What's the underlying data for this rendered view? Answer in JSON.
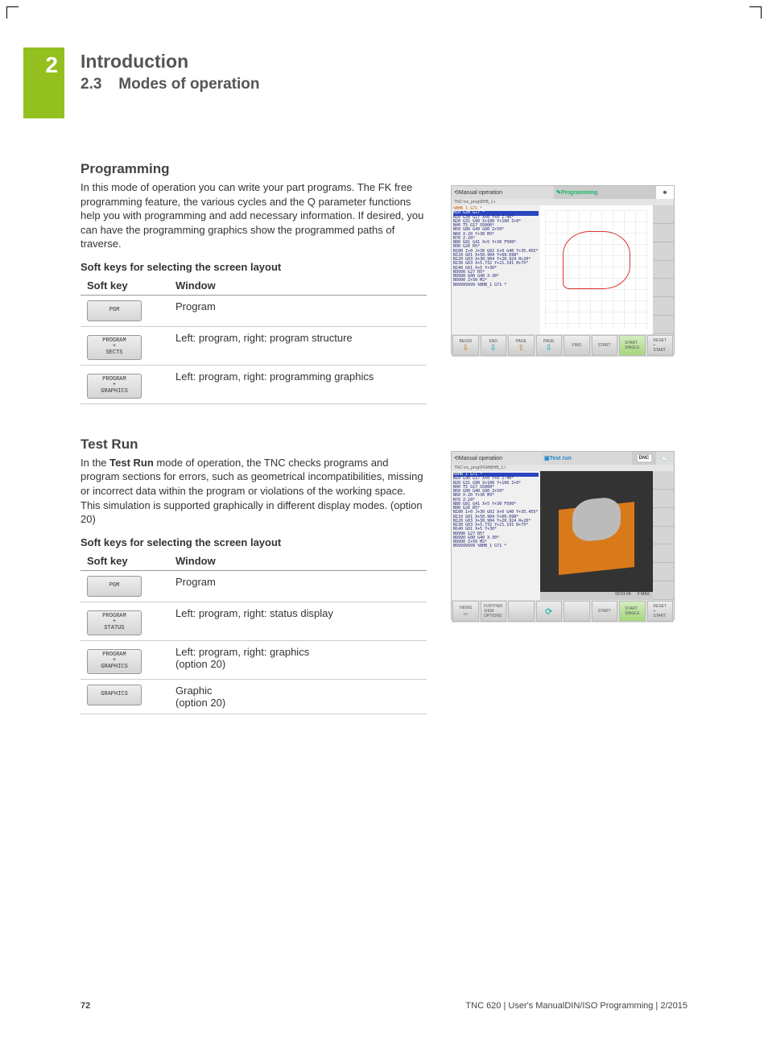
{
  "chapter": {
    "number": "2",
    "title": "Introduction",
    "sectionNum": "2.3",
    "sectionTitle": "Modes of operation"
  },
  "prog": {
    "heading": "Programming",
    "para": "In this mode of operation you can write your part programs. The FK free programming feature, the various cycles and the Q parameter functions help you with programming and add necessary information. If desired, you can have the programming graphics show the programmed paths of traverse.",
    "tableTitle": "Soft keys for selecting the screen layout",
    "h1": "Soft key",
    "h2": "Window",
    "r1": {
      "k1": "PGM",
      "w": "Program"
    },
    "r2": {
      "k1": "PROGRAM",
      "k2": "+",
      "k3": "SECTS",
      "w": "Left: program, right: program structure"
    },
    "r3": {
      "k1": "PROGRAM",
      "k2": "+",
      "k3": "GRAPHICS",
      "w": "Left: program, right: programming graphics"
    }
  },
  "test": {
    "heading": "Test Run",
    "para1": "In the ",
    "bold": "Test Run",
    "para2": " mode of operation, the TNC checks programs and program sections for errors, such as geometrical incompatibilities, missing or incorrect data within the program or violations of the working space. This simulation is supported graphically in different display modes. (option 20)",
    "tableTitle": "Soft keys for selecting the screen layout",
    "h1": "Soft key",
    "h2": "Window",
    "r1": {
      "k1": "PGM",
      "w": "Program"
    },
    "r2": {
      "k1": "PROGRAM",
      "k2": "+",
      "k3": "STATUS",
      "w": "Left: program, right: status display"
    },
    "r3": {
      "k1": "PROGRAM",
      "k2": "+",
      "k3": "GRAPHICS",
      "w1": "Left: program, right: graphics",
      "w2": "(option 20)"
    },
    "r4": {
      "k1": "GRAPHICS",
      "w1": "Graphic",
      "w2": "(option 20)"
    }
  },
  "ss1": {
    "tab1": "Manual operation",
    "tab2": "Programming",
    "sub": "Programming",
    "path": "TNC:\\nc_prog\\BHB_1.i",
    "line0": "%BHB_1 G71 *",
    "hl": "N10 G30 G17 *",
    "code": "N10 G30 G17 X+0 Y+0 Z-40*\nN20 G31 G90 X+100 Y+100 Z+0*\nN40 T5 G17 S5000*\nN50 G00 G40 G90 Z+50*\nN60 X-20 Y+30 M3*\nN70 Z-20*\nN80 G01 G41 X+5 Y+30 F500*\nN90 G26 R5*\nN100 I+0 J+30 G02 X+0 G40 Y+35.455*\nN110 G01 X+50.904 Y+60.698*\nN120 G03 X+30.904 Y+20.924 R+20*\nN130 G03 X+5.732 Y+21.191 R+75*\nN140 G01 X+5 Y+30*\nN9990 G27 R5*\nN9990 G00 G40 X-30*\nN9990 Z+50 M2*\nN99999999 %BHB_1 G71 *",
    "buttons": [
      "BEGIN",
      "END",
      "PAGE",
      "PAGE",
      "FIND",
      "START",
      "START\nSINGLE",
      "RESET\n+\nSTART"
    ]
  },
  "ss2": {
    "tab1": "Manual operation",
    "tab2": "Test run",
    "dnc": "DNC",
    "path": "TNC:\\nc_prog\\PGM\\BHB_1.I",
    "hl": "%BHB_1 G71 *",
    "code": "N10 G30 G17 X+0 Y+0 Z-40*\nN20 G31 G90 X+100 Y+100 Z+0*\nN40 T5 G17 S5000*\nN50 G00 G40 G90 Z+50*\nN60 X-20 Y+30 M3*\nN70 Z-20*\nN80 G01 G41 X+5 Y+30 F500*\nN90 G26 R5*\nN100 I+0 J+30 G02 X+0 G40 Y+35.455*\nN110 G01 X+50.904 Y+60.698*\nN120 G03 X+30.904 Y+20.924 R+20*\nN130 G03 X+5.732 Y+21.191 R+75*\nN140 G01 X+5 Y+30*\nN9990 G27 R5*\nN9990 G00 G40 X-30*\nN9990 Z+50 M2*\nN99999999 %BHB_1 G71 *",
    "bbar": {
      "time": "00:01:04",
      "fmax": "F MAX"
    },
    "buttons": [
      "VIEWS",
      "FURTHER\nVIEW\nOPTIONS",
      "",
      "",
      "",
      "START",
      "START\nSINGLE",
      "RESET\n+\nSTART"
    ]
  },
  "footer": {
    "page": "72",
    "ref": "TNC 620 | User's ManualDIN/ISO Programming | 2/2015"
  }
}
